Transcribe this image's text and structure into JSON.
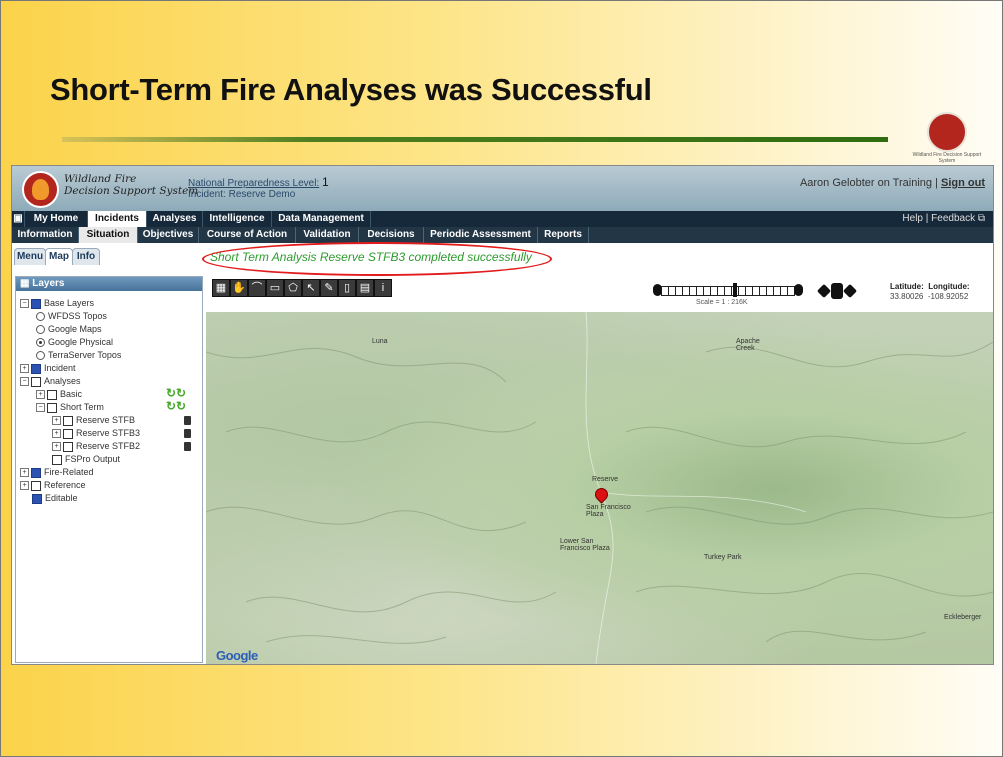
{
  "slide": {
    "title": "Short-Term Fire Analyses was Successful",
    "logo_caption": "Wildland Fire Decision Support System"
  },
  "app": {
    "logo_line1": "Wildland Fire",
    "logo_line2": "Decision Support System",
    "npl_label": "National Preparedness Level:",
    "npl_value": "1",
    "incident_label": "Incident:",
    "incident_value": "Reserve Demo",
    "user_text": "Aaron Gelobter on Training |",
    "sign_out": "Sign out"
  },
  "nav_primary": {
    "items": [
      "My Home",
      "Incidents",
      "Analyses",
      "Intelligence",
      "Data Management"
    ],
    "active": "Incidents",
    "help": "Help",
    "feedback": "Feedback"
  },
  "nav_secondary": {
    "items": [
      "Information",
      "Situation",
      "Objectives",
      "Course of Action",
      "Validation",
      "Decisions",
      "Periodic Assessment",
      "Reports"
    ],
    "active": "Situation"
  },
  "side_tabs": [
    "Menu",
    "Map",
    "Info"
  ],
  "status_message": "Short Term Analysis Reserve STFB3 completed successfully",
  "layers": {
    "title": "Layers",
    "base_layers": "Base Layers",
    "base_options": [
      "WFDSS Topos",
      "Google Maps",
      "Google Physical",
      "TerraServer Topos"
    ],
    "selected_base": "Google Physical",
    "incident": "Incident",
    "analyses": "Analyses",
    "basic": "Basic",
    "short_term": "Short Term",
    "short_term_items": [
      "Reserve STFB",
      "Reserve STFB3",
      "Reserve STFB2"
    ],
    "fspro": "FSPro Output",
    "fire_related": "Fire-Related",
    "reference": "Reference",
    "editable": "Editable"
  },
  "map": {
    "scale": "Scale = 1 : 216K",
    "latitude_label": "Latitude:",
    "latitude": "33.80026",
    "longitude_label": "Longitude:",
    "longitude": "-108.92052",
    "places": [
      "Luna",
      "Apache Creek",
      "Reserve",
      "San Francisco Plaza",
      "Lower San Francisco Plaza",
      "Turkey Park",
      "Eckleberger"
    ],
    "attribution": "Google"
  },
  "colors": {
    "success_green": "#2d9b2d",
    "highlight_red": "#e21c1c",
    "nav_dark": "#16293a"
  }
}
